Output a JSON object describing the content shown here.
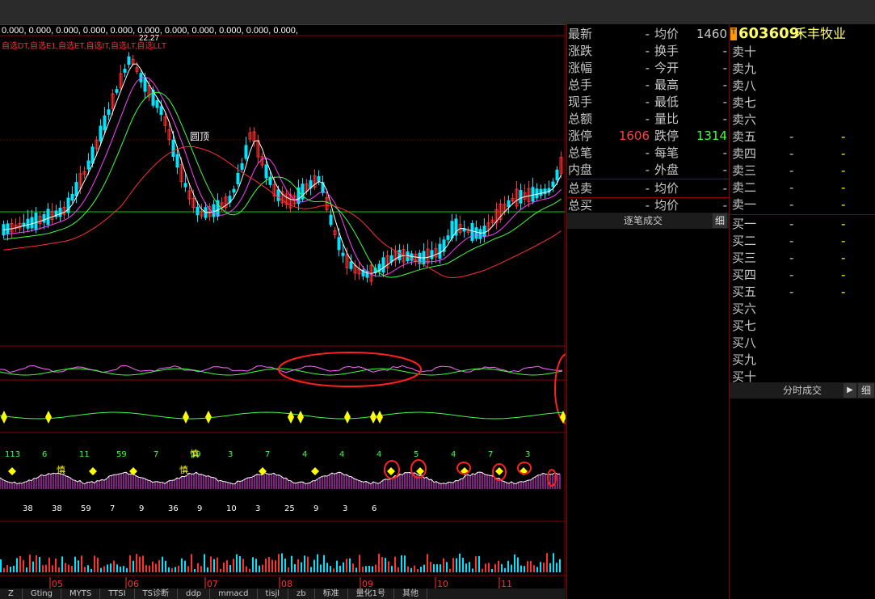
{
  "indicator_header": {
    "values": "0.000, 0.000, 0.000, 0.000, 0.000, 0.000, 0.000, 0.000, 0.000, 0.000, 0.000,"
  },
  "selection_legend": "自选DT,自选E1,自选ET,自选IT,自选LT,自选LLT",
  "price_labels": {
    "high": "22.27",
    "round_top": "圆顶"
  },
  "months": [
    "05",
    "06",
    "07",
    "08",
    "09",
    "10",
    "11"
  ],
  "macd_numbers": [
    "113",
    "6",
    "11",
    "59",
    "7",
    "19",
    "3",
    "7",
    "4",
    "4",
    "4",
    "5",
    "4",
    "7",
    "3"
  ],
  "macd_bottom_numbers": [
    "38",
    "38",
    "59",
    "7",
    "9",
    "36",
    "9",
    "10",
    "3",
    "25",
    "9",
    "3",
    "6"
  ],
  "caution_label": "慎",
  "bottom_tabs": [
    "Z",
    "Gting",
    "MYTS",
    "TTSI",
    "TS诊断",
    "ddp",
    "mmacd",
    "tisjl",
    "zb",
    "标准",
    "量化1号",
    "其他"
  ],
  "quote": {
    "rows": [
      {
        "k": "最新",
        "v": "-",
        "k2": "均价",
        "v2": "1460"
      },
      {
        "k": "涨跌",
        "v": "-",
        "k2": "换手",
        "v2": "-"
      },
      {
        "k": "涨幅",
        "v": "-",
        "k2": "今开",
        "v2": "-"
      },
      {
        "k": "总手",
        "v": "-",
        "k2": "最高",
        "v2": "-"
      },
      {
        "k": "现手",
        "v": "-",
        "k2": "最低",
        "v2": "-"
      },
      {
        "k": "总额",
        "v": "-",
        "k2": "量比",
        "v2": "-"
      },
      {
        "k": "涨停",
        "v": "1606",
        "k2": "跌停",
        "v2": "1314"
      },
      {
        "k": "总笔",
        "v": "-",
        "k2": "每笔",
        "v2": "-"
      },
      {
        "k": "内盘",
        "v": "-",
        "k2": "外盘",
        "v2": "-"
      },
      {
        "k": "总卖",
        "v": "-",
        "k2": "均价",
        "v2": "-"
      },
      {
        "k": "总买",
        "v": "-",
        "k2": "均价",
        "v2": "-"
      }
    ],
    "tab_label": "逐笔成交",
    "tab_btn": "细"
  },
  "book": {
    "badge": "T",
    "code": "603609",
    "name": "禾丰牧业",
    "rows": [
      {
        "k": "卖十",
        "p": "",
        "q": ""
      },
      {
        "k": "卖九",
        "p": "",
        "q": ""
      },
      {
        "k": "卖八",
        "p": "",
        "q": ""
      },
      {
        "k": "卖七",
        "p": "",
        "q": ""
      },
      {
        "k": "卖六",
        "p": "",
        "q": ""
      },
      {
        "k": "卖五",
        "p": "-",
        "q": "-"
      },
      {
        "k": "卖四",
        "p": "-",
        "q": "-"
      },
      {
        "k": "卖三",
        "p": "-",
        "q": "-"
      },
      {
        "k": "卖二",
        "p": "-",
        "q": "-"
      },
      {
        "k": "卖一",
        "p": "-",
        "q": "-"
      },
      {
        "k": "买一",
        "p": "-",
        "q": "-"
      },
      {
        "k": "买二",
        "p": "-",
        "q": "-"
      },
      {
        "k": "买三",
        "p": "-",
        "q": "-"
      },
      {
        "k": "买四",
        "p": "-",
        "q": "-"
      },
      {
        "k": "买五",
        "p": "-",
        "q": "-"
      },
      {
        "k": "买六",
        "p": "",
        "q": ""
      },
      {
        "k": "买七",
        "p": "",
        "q": ""
      },
      {
        "k": "买八",
        "p": "",
        "q": ""
      },
      {
        "k": "买九",
        "p": "",
        "q": ""
      },
      {
        "k": "买十",
        "p": "",
        "q": ""
      }
    ],
    "tab_label": "分时成交",
    "tab_arrow": "▶",
    "tab_btn": "细"
  },
  "colors": {
    "up": "#ff3030",
    "down": "#00e5ff",
    "ma5": "#ffffff",
    "ma10": "#ff40ff",
    "ma20": "#40ff40",
    "ma60": "#ff3030",
    "grid": "#8b0000"
  },
  "chart_data": {
    "type": "candlestick",
    "x_groups": [
      "05",
      "06",
      "07",
      "08",
      "09",
      "10",
      "11"
    ],
    "y_high_label": 22.27
  }
}
